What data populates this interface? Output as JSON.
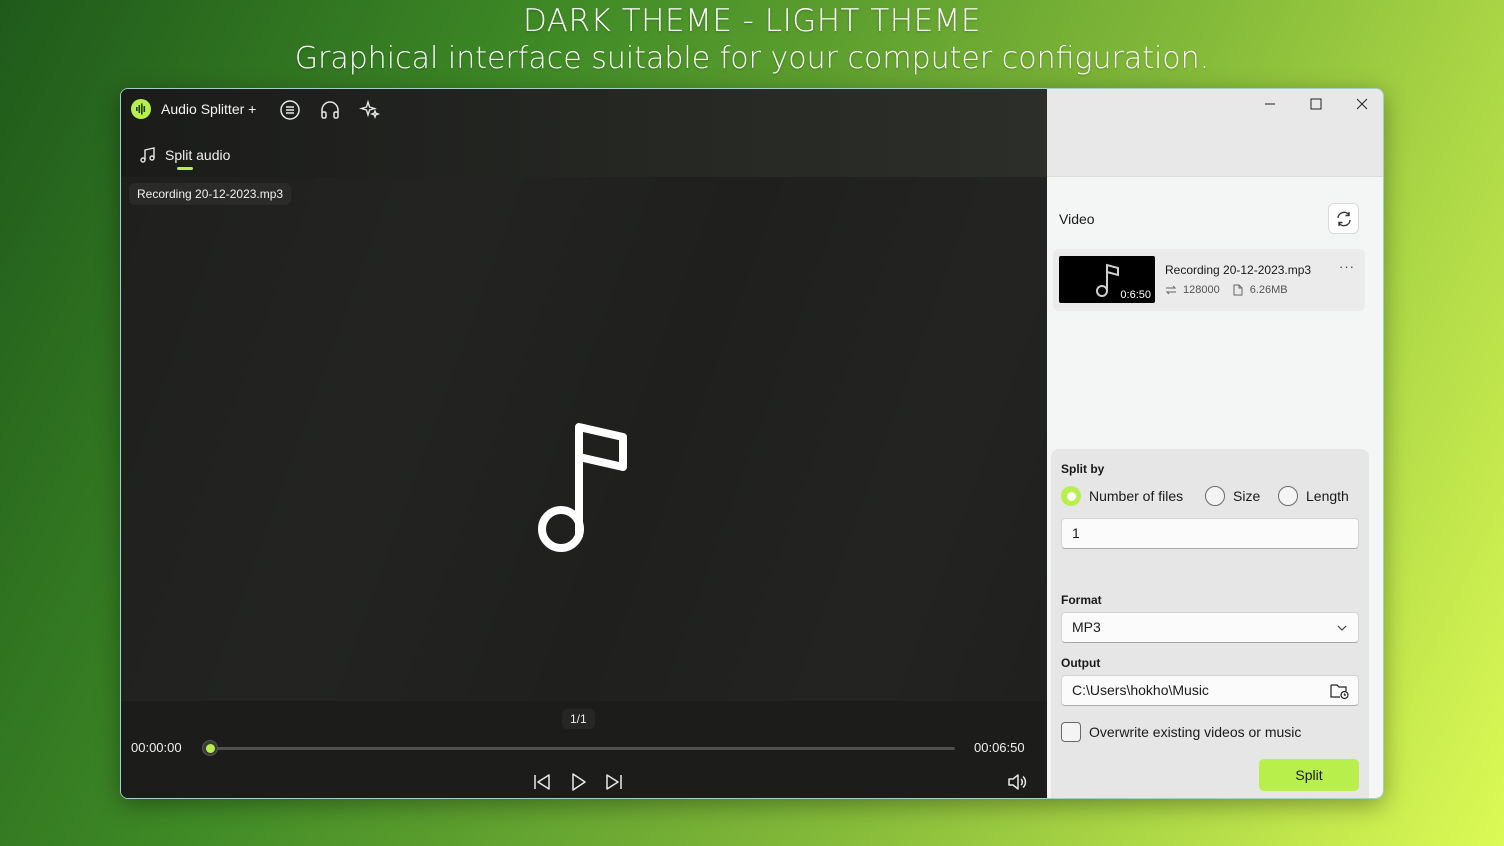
{
  "banner": {
    "line1": "DARK THEME - LIGHT THEME",
    "line2": "Graphical interface suitable for your computer configuration."
  },
  "app": {
    "title": "Audio Splitter +",
    "accent": "#b8ef4a"
  },
  "tabs": [
    {
      "label": "Split audio",
      "icon": "music-note-icon",
      "active": true
    }
  ],
  "player": {
    "file_name": "Recording 20-12-2023.mp3",
    "counter": "1/1",
    "current_time": "00:00:00",
    "total_time": "00:06:50",
    "progress": 0
  },
  "sidebar": {
    "section_title": "Video",
    "files": [
      {
        "name": "Recording 20-12-2023.mp3",
        "duration": "0:6:50",
        "bitrate": "128000",
        "size": "6.26MB",
        "more": "···"
      }
    ]
  },
  "settings": {
    "split_by_label": "Split by",
    "split_options": [
      {
        "label": "Number of files",
        "selected": true
      },
      {
        "label": "Size",
        "selected": false
      },
      {
        "label": "Length",
        "selected": false
      }
    ],
    "split_value": "1",
    "format_label": "Format",
    "format_value": "MP3",
    "output_label": "Output",
    "output_value": "C:\\Users\\hokho\\Music",
    "overwrite_label": "Overwrite existing videos or music",
    "overwrite_checked": false,
    "split_button": "Split"
  }
}
